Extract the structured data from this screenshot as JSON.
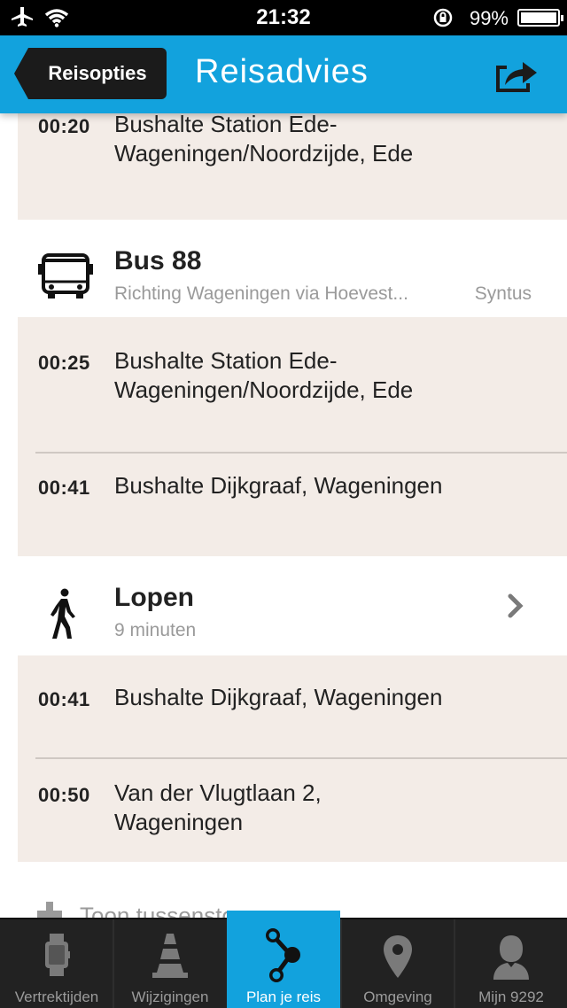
{
  "status_bar": {
    "time": "21:32",
    "battery": "99%"
  },
  "nav": {
    "back_label": "Reisopties",
    "title": "Reisadvies"
  },
  "first_card": {
    "time": "00:20",
    "stop": "Bushalte Station Ede-Wageningen/Noordzijde, Ede"
  },
  "bus_leg": {
    "title": "Bus 88",
    "direction": "Richting Wageningen via Hoevest...",
    "operator": "Syntus",
    "stops": [
      {
        "time": "00:25",
        "name": "Bushalte Station Ede-Wageningen/Noordzijde, Ede"
      },
      {
        "time": "00:41",
        "name": "Bushalte Dijkgraaf, Wageningen"
      }
    ]
  },
  "walk_leg": {
    "title": "Lopen",
    "duration": "9 minuten",
    "stops": [
      {
        "time": "00:41",
        "name": "Bushalte Dijkgraaf, Wageningen"
      },
      {
        "time": "00:50",
        "name": "Van der Vlugtlaan 2, Wageningen"
      }
    ]
  },
  "toon_label": "Toon tussenstops",
  "tabs": [
    {
      "label": "Vertrektijden",
      "icon": "watch-icon"
    },
    {
      "label": "Wijzigingen",
      "icon": "traffic-cone-icon"
    },
    {
      "label": "Plan je reis",
      "icon": "route-icon",
      "active": true
    },
    {
      "label": "Omgeving",
      "icon": "location-pin-icon"
    },
    {
      "label": "Mijn 9292",
      "icon": "person-icon"
    }
  ],
  "colors": {
    "accent": "#12a2dd",
    "card": "#f3ece7",
    "tabbar": "#222222"
  }
}
